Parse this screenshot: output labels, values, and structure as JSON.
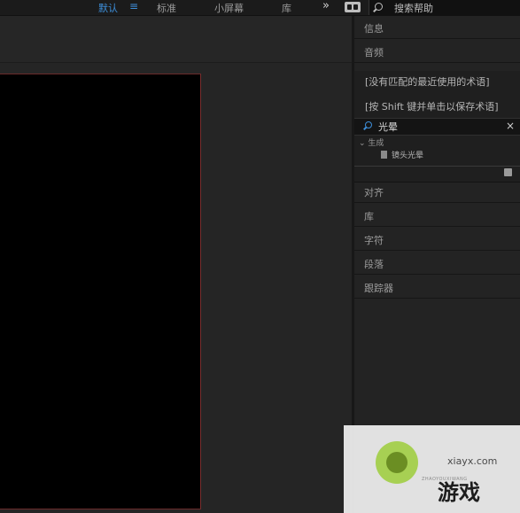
{
  "workspace_bar": {
    "default_label": "默认",
    "menu_glyph": "≡",
    "standard_label": "标准",
    "small_screen_label": "小屏幕",
    "library_label": "库",
    "more_glyph": "»",
    "search_help_placeholder": "搜索帮助"
  },
  "right_panels": {
    "info_label": "信息",
    "audio_label": "音频",
    "effects_presets": {
      "no_recent_terms": "[没有匹配的最近使用的术语]",
      "shift_click_hint": "[按 Shift 键并单击以保存术语]",
      "search_value": "光晕",
      "clear_glyph": "×",
      "category_label": "⌄ 生成",
      "result_item_label": "镜头光晕"
    },
    "align_label": "对齐",
    "library_label": "库",
    "character_label": "字符",
    "paragraph_label": "段落",
    "tracker_label": "跟踪器"
  },
  "watermark": {
    "url": "xiayx.com",
    "small_text": "ZHAOYOUXIWANG",
    "title": "游戏"
  },
  "colors": {
    "accent_blue": "#3d8ed9",
    "panel_bg": "#232323",
    "canvas_border": "#7a2e2e"
  }
}
